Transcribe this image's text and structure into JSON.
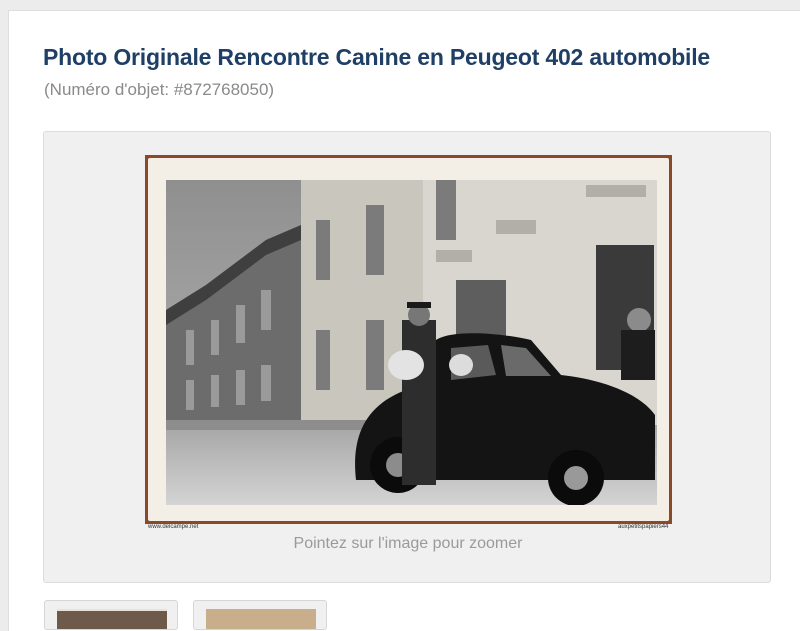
{
  "item": {
    "title": "Photo Originale Rencontre Canine en Peugeot 402 automobile",
    "number_label": "(Numéro d'objet: #872768050)"
  },
  "gallery": {
    "zoom_hint": "Pointez sur l'image pour zoomer",
    "credit_left": "www.delcampe.net",
    "credit_right": "auxpetitspapiers44",
    "thumbnail_count": 2
  },
  "colors": {
    "title": "#1f3f66",
    "muted_text": "#8a8a8a",
    "frame_border": "#8a4a2a"
  }
}
